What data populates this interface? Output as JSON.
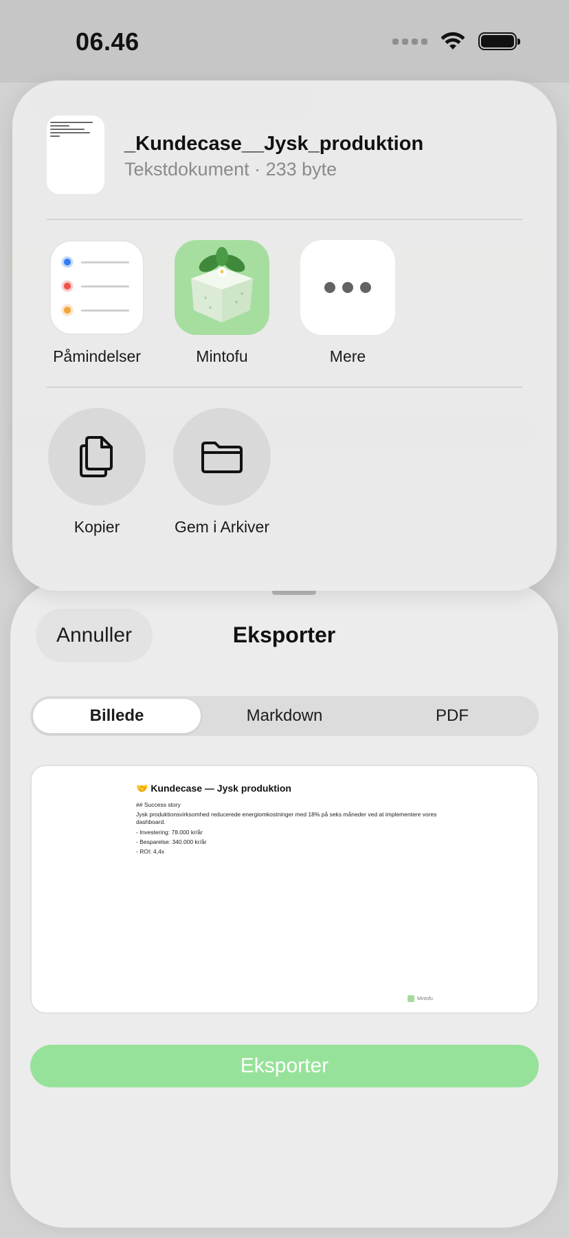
{
  "status_bar": {
    "time": "06.46"
  },
  "share_sheet": {
    "file_name": "_Kundecase__Jysk_produktion",
    "file_meta": "Tekstdokument · 233 byte",
    "apps": [
      {
        "label": "Påmindelser",
        "icon": "reminders-app-icon"
      },
      {
        "label": "Mintofu",
        "icon": "mintofu-app-icon"
      },
      {
        "label": "Mere",
        "icon": "more-icon"
      }
    ],
    "actions": [
      {
        "label": "Kopier",
        "icon": "copy-icon"
      },
      {
        "label": "Gem i Arkiver",
        "icon": "folder-icon"
      }
    ]
  },
  "export_sheet": {
    "cancel_label": "Annuller",
    "title": "Eksporter",
    "tabs": [
      {
        "label": "Billede",
        "active": true
      },
      {
        "label": "Markdown",
        "active": false
      },
      {
        "label": "PDF",
        "active": false
      }
    ],
    "preview": {
      "title": "🤝 Kundecase — Jysk produktion",
      "heading": "## Success story",
      "paragraph": "Jysk produktionsvirksomhed reducerede energiomkostninger med 18% på seks måneder ved at implementere vores dashboard.",
      "bullets": [
        "- Investering: 78.000 kr/år",
        "- Besparelse: 340.000 kr/år",
        "- ROI: 4,4x"
      ],
      "footer": "Mintofu"
    },
    "export_button_label": "Eksporter"
  },
  "colors": {
    "accent_green": "#97e29a",
    "reminder_blue": "#2f7cf6",
    "reminder_red": "#f0524a",
    "reminder_orange": "#f4a53a"
  }
}
